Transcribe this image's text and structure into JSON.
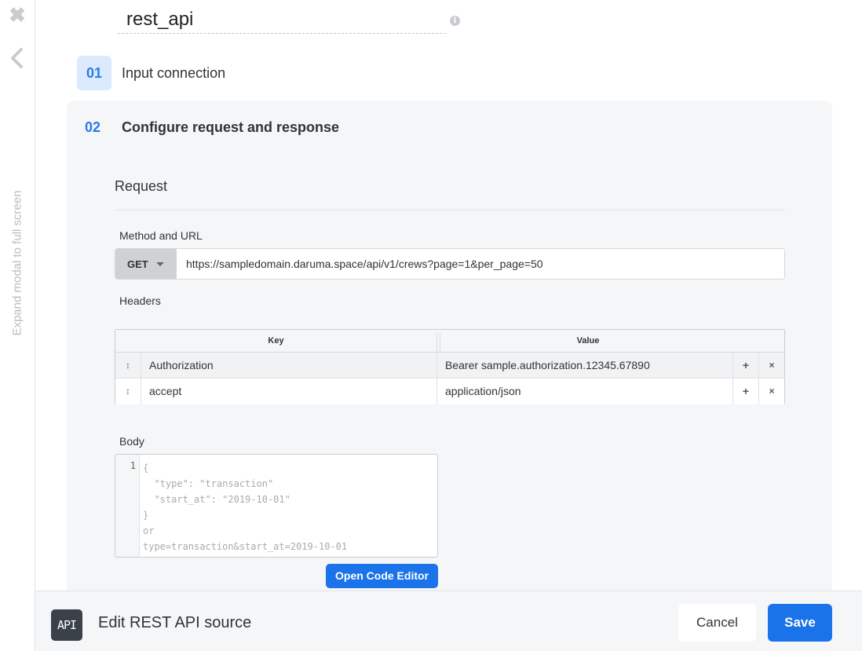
{
  "left_rail": {
    "close_icon": "close-icon",
    "back_icon": "chevron-left-icon",
    "expand_label": "Expand modal to full screen"
  },
  "source_name": "rest_api",
  "info_icon": "info-icon",
  "steps": {
    "step1": {
      "number": "01",
      "label": "Input connection"
    },
    "step2": {
      "number": "02",
      "label": "Configure request and response"
    }
  },
  "request": {
    "section_title": "Request",
    "method_url_label": "Method and URL",
    "method": "GET",
    "url": "https://sampledomain.daruma.space/api/v1/crews?page=1&per_page=50",
    "headers_label": "Headers",
    "headers_columns": {
      "key": "Key",
      "value": "Value"
    },
    "headers": [
      {
        "key": "Authorization",
        "value": "Bearer sample.authorization.12345.67890"
      },
      {
        "key": "accept",
        "value": "application/json"
      }
    ],
    "row_controls": {
      "drag": "↕",
      "add": "+",
      "remove": "×"
    },
    "body_label": "Body",
    "body_line_number": "1",
    "body_placeholder_lines": [
      "{",
      "  \"type\": \"transaction\"",
      "  \"start_at\": \"2019-10-01\"",
      "}",
      "or",
      "type=transaction&start_at=2019-10-01"
    ],
    "open_code_editor": "Open Code Editor"
  },
  "footer": {
    "logo_text": "API",
    "title": "Edit REST API source",
    "cancel": "Cancel",
    "save": "Save"
  },
  "colors": {
    "accent": "#1a73e8",
    "step_blue": "#2a7be4",
    "panel_bg": "#f5f6f8"
  }
}
